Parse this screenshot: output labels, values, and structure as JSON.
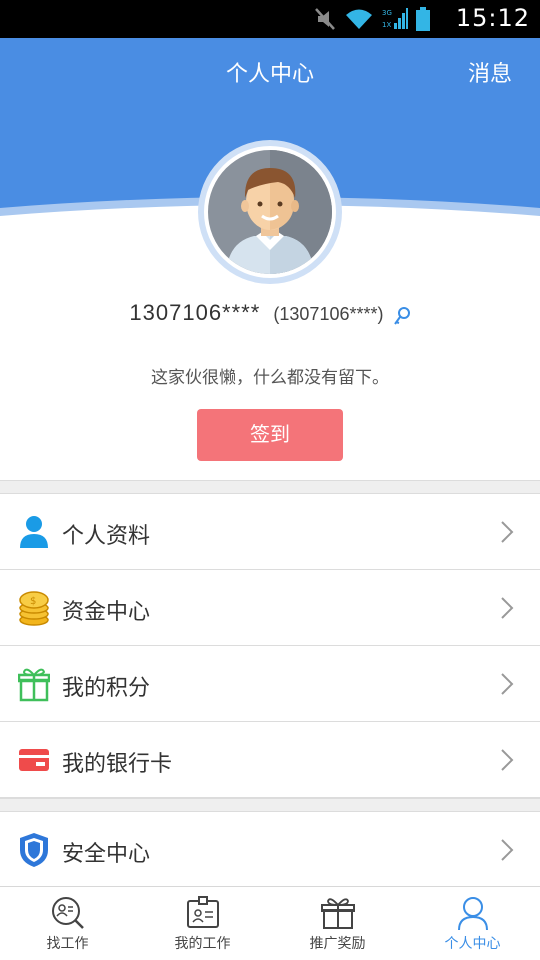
{
  "status_bar": {
    "time": "15:12"
  },
  "header": {
    "title": "个人中心",
    "message_label": "消息"
  },
  "profile": {
    "username": "1307106****",
    "username_sub": "(1307106****)",
    "signature": "这家伙很懒，什么都没有留下。",
    "checkin_label": "签到"
  },
  "menu": {
    "items": [
      {
        "label": "个人资料",
        "icon": "person-icon"
      },
      {
        "label": "资金中心",
        "icon": "coins-icon"
      },
      {
        "label": "我的积分",
        "icon": "gift-icon"
      },
      {
        "label": "我的银行卡",
        "icon": "bank-card-icon"
      },
      {
        "label": "安全中心",
        "icon": "shield-icon"
      }
    ]
  },
  "bottom_nav": {
    "items": [
      {
        "label": "找工作",
        "icon": "search-resume-icon",
        "active": false
      },
      {
        "label": "我的工作",
        "icon": "id-badge-icon",
        "active": false
      },
      {
        "label": "推广奖励",
        "icon": "gift-box-icon",
        "active": false
      },
      {
        "label": "个人中心",
        "icon": "user-icon",
        "active": true
      }
    ]
  },
  "colors": {
    "header_bg": "#4a8de3",
    "checkin_bg": "#f47479",
    "active_tab": "#3a8ee6"
  }
}
